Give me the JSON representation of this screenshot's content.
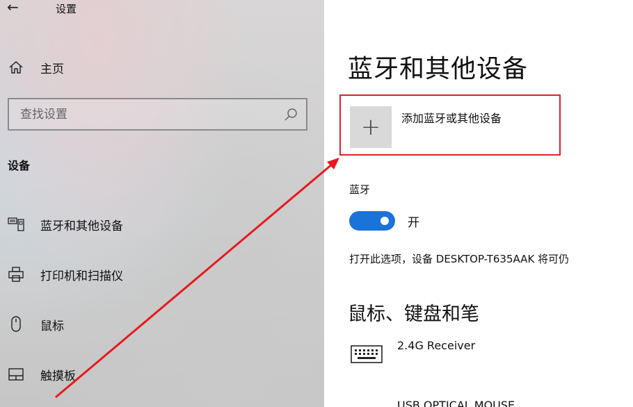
{
  "window": {
    "back_icon": "back-arrow-icon",
    "title": "设置"
  },
  "sidebar": {
    "home": {
      "icon": "home-icon",
      "label": "主页"
    },
    "search": {
      "placeholder": "查找设置",
      "icon": "search-icon"
    },
    "section_title": "设备",
    "items": [
      {
        "icon": "bluetooth-devices-icon",
        "label": "蓝牙和其他设备"
      },
      {
        "icon": "printer-icon",
        "label": "打印机和扫描仪"
      },
      {
        "icon": "mouse-icon",
        "label": "鼠标"
      },
      {
        "icon": "touchpad-icon",
        "label": "触摸板"
      }
    ]
  },
  "main": {
    "title": "蓝牙和其他设备",
    "add_device": {
      "icon": "plus-icon",
      "label": "添加蓝牙或其他设备"
    },
    "bluetooth": {
      "label": "蓝牙",
      "toggle_on": true,
      "toggle_state": "开",
      "description": "打开此选项，设备 DESKTOP-T635AAK 将可仍"
    },
    "section2_title": "鼠标、键盘和笔",
    "devices": [
      {
        "icon": "keyboard-icon",
        "name": "2.4G Receiver"
      },
      {
        "name": "USB OPTICAL MOUSE"
      }
    ]
  },
  "colors": {
    "accent": "#1a73d9",
    "highlight": "#e0202a"
  }
}
